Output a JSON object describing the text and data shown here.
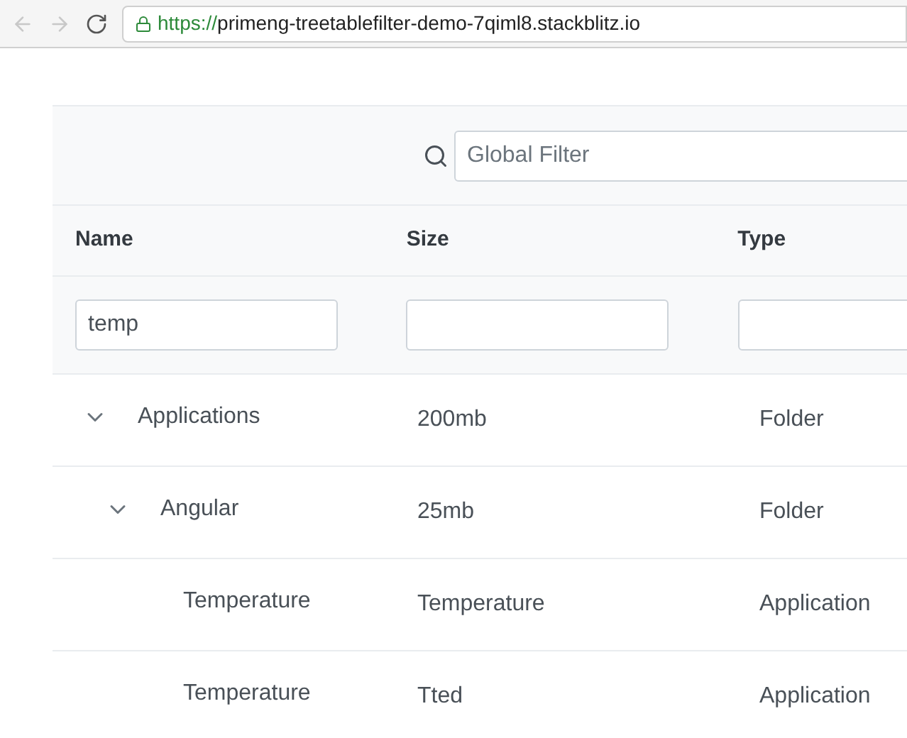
{
  "browser": {
    "back_disabled": true,
    "forward_disabled": true,
    "url_scheme": "https://",
    "url_host": "primeng-treetablefilter-demo-7qiml8.stackblitz.io"
  },
  "global_filter": {
    "placeholder": "Global Filter"
  },
  "table": {
    "columns": [
      {
        "label": "Name",
        "filter": "temp"
      },
      {
        "label": "Size"
      },
      {
        "label": "Type"
      }
    ],
    "rows": [
      {
        "name": "Applications",
        "size": "200mb",
        "type": "Folder",
        "expanded": true,
        "children": [
          {
            "name": "Angular",
            "size": "25mb",
            "type": "Folder",
            "expanded": true,
            "children": [
              {
                "name": "Temperature",
                "size": "Temperature",
                "type": "Application"
              },
              {
                "name": "Temperature",
                "size": "Tted",
                "type": "Application"
              }
            ]
          }
        ]
      }
    ]
  }
}
